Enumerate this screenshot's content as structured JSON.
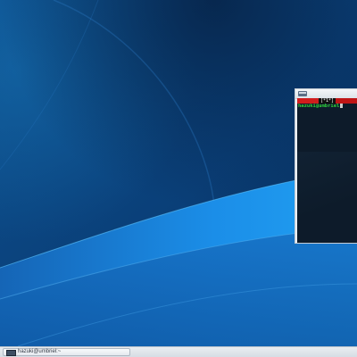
{
  "colors": {
    "wallpaper_dark": "#072a52",
    "wallpaper_mid": "#0d5ea8",
    "wallpaper_light": "#1a8fe6",
    "terminal_bg": "#0d1b2a",
    "prompt_green": "#2fd13a",
    "tmux_red": "#c01515",
    "taskbar": "#e3e8ee"
  },
  "terminal": {
    "tmux_window_label": "[*1*]",
    "prompt": "hazuki@umbriel",
    "icon": "terminal-icon"
  },
  "taskbar": {
    "task_label": "hazuki@umbriel:~",
    "task_icon": "terminal-icon"
  }
}
